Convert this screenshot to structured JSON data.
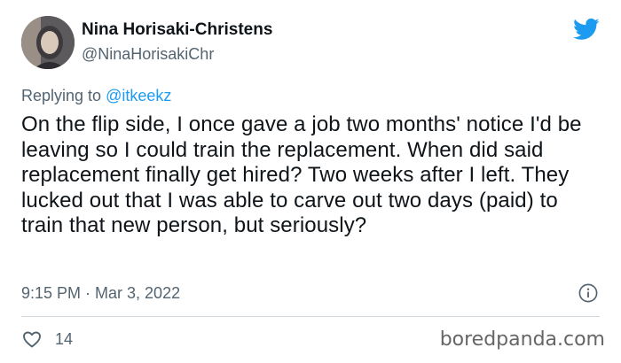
{
  "author": {
    "display_name": "Nina Horisaki-Christens",
    "handle": "@NinaHorisakiChr"
  },
  "reply": {
    "prefix": "Replying to ",
    "mention": "@itkeekz"
  },
  "tweet": {
    "text": "On the flip side, I once gave a job two months' notice I'd be leaving so I could train the replacement. When did said replacement finally get hired? Two weeks after I left. They lucked out that I was able to carve out two days (paid) to train that new person, but seriously?",
    "timestamp": "9:15 PM · Mar 3, 2022"
  },
  "actions": {
    "like_count": "14"
  },
  "watermark": "boredpanda.com",
  "colors": {
    "twitter_blue": "#1d9bf0",
    "secondary_text": "#536471",
    "primary_text": "#0f1419",
    "divider": "#cfd9de"
  },
  "icons": {
    "brand": "twitter-bird-icon",
    "info": "info-icon",
    "like": "heart-icon"
  }
}
